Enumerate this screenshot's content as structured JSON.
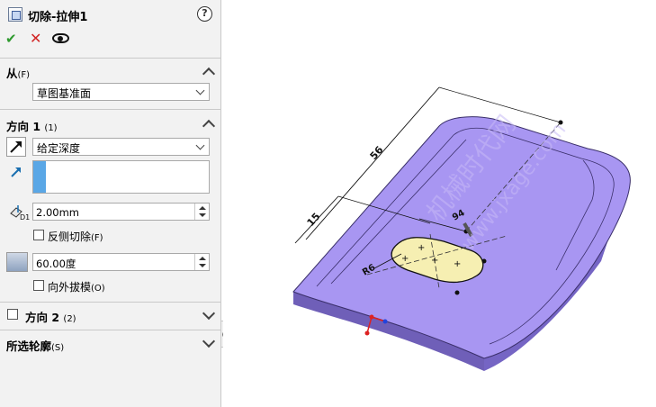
{
  "header": {
    "title": "切除-拉伸1",
    "help": "?"
  },
  "actions": {
    "ok": "✔",
    "cancel": "✕"
  },
  "from": {
    "title": "从",
    "accel": "(F)",
    "selected": "草图基准面"
  },
  "direction1": {
    "title": "方向 1",
    "accel": "(1)",
    "end_condition": "给定深度",
    "depth": "2.00mm",
    "reverse_cut_label": "反侧切除",
    "reverse_cut_accel": "(F)",
    "draft_angle": "60.00度",
    "draft_outward_label": "向外拔模",
    "draft_outward_accel": "(O)"
  },
  "direction2": {
    "title": "方向 2",
    "accel": "(2)"
  },
  "contours": {
    "title": "所选轮廓",
    "accel": "(S)"
  },
  "viewport": {
    "dim_56": "56",
    "dim_15": "15",
    "dim_94": "94",
    "dim_r6": "R6",
    "watermark_cn": "机械时代网",
    "watermark_url": "www.jxage.com",
    "part_color": "#a896f2"
  }
}
